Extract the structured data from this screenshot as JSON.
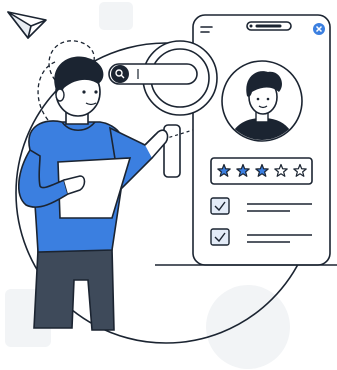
{
  "search": {
    "query": ""
  },
  "rating": {
    "value": 3,
    "max": 5
  },
  "checklist": [
    {
      "checked": true
    },
    {
      "checked": true
    }
  ],
  "colors": {
    "outline": "#1b2431",
    "accent_blue": "#3b7fe0",
    "star_fill": "#3b7fe0",
    "pants": "#3e4a5a",
    "panel_bg": "#f2f4f6",
    "skin": "#ffffff"
  }
}
